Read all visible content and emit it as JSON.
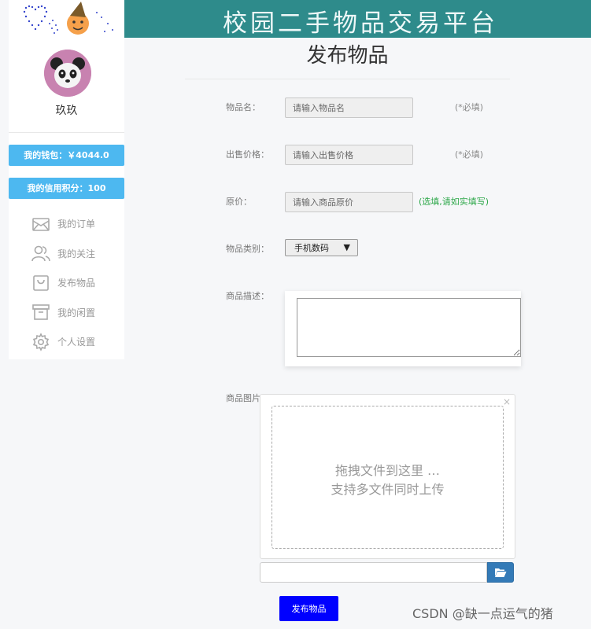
{
  "header": {
    "site_title": "校园二手物品交易平台"
  },
  "sidebar": {
    "username": "玖玖",
    "wallet": "我的钱包：￥4044.0",
    "credit": "我的信用积分：100",
    "menu": [
      {
        "label": "我的订单",
        "icon": "envelope-icon"
      },
      {
        "label": "我的关注",
        "icon": "users-icon"
      },
      {
        "label": "发布物品",
        "icon": "bag-icon"
      },
      {
        "label": "我的闲置",
        "icon": "archive-icon"
      },
      {
        "label": "个人设置",
        "icon": "gear-icon"
      }
    ]
  },
  "form": {
    "title": "发布物品",
    "name_label": "物品名：",
    "name_placeholder": "请输入物品名",
    "name_hint": "(*必填)",
    "price_label": "出售价格：",
    "price_placeholder": "请输入出售价格",
    "price_hint": "(*必填)",
    "orig_label": "原价：",
    "orig_placeholder": "请输入商品原价",
    "orig_hint": "(选填,请如实填写)",
    "category_label": "物品类别：",
    "category_value": "手机数码",
    "desc_label": "商品描述：",
    "image_label": "商品图片：",
    "drop_line1": "拖拽文件到这里 …",
    "drop_line2": "支持多文件同时上传",
    "submit_label": "发布物品"
  },
  "colors": {
    "banner": "#2e8b8b",
    "badge": "#4db8f0",
    "submit": "#0000ff",
    "hint_green": "#2ea84a",
    "browse": "#337ab7"
  },
  "watermark": "CSDN @缺一点运气的猪"
}
